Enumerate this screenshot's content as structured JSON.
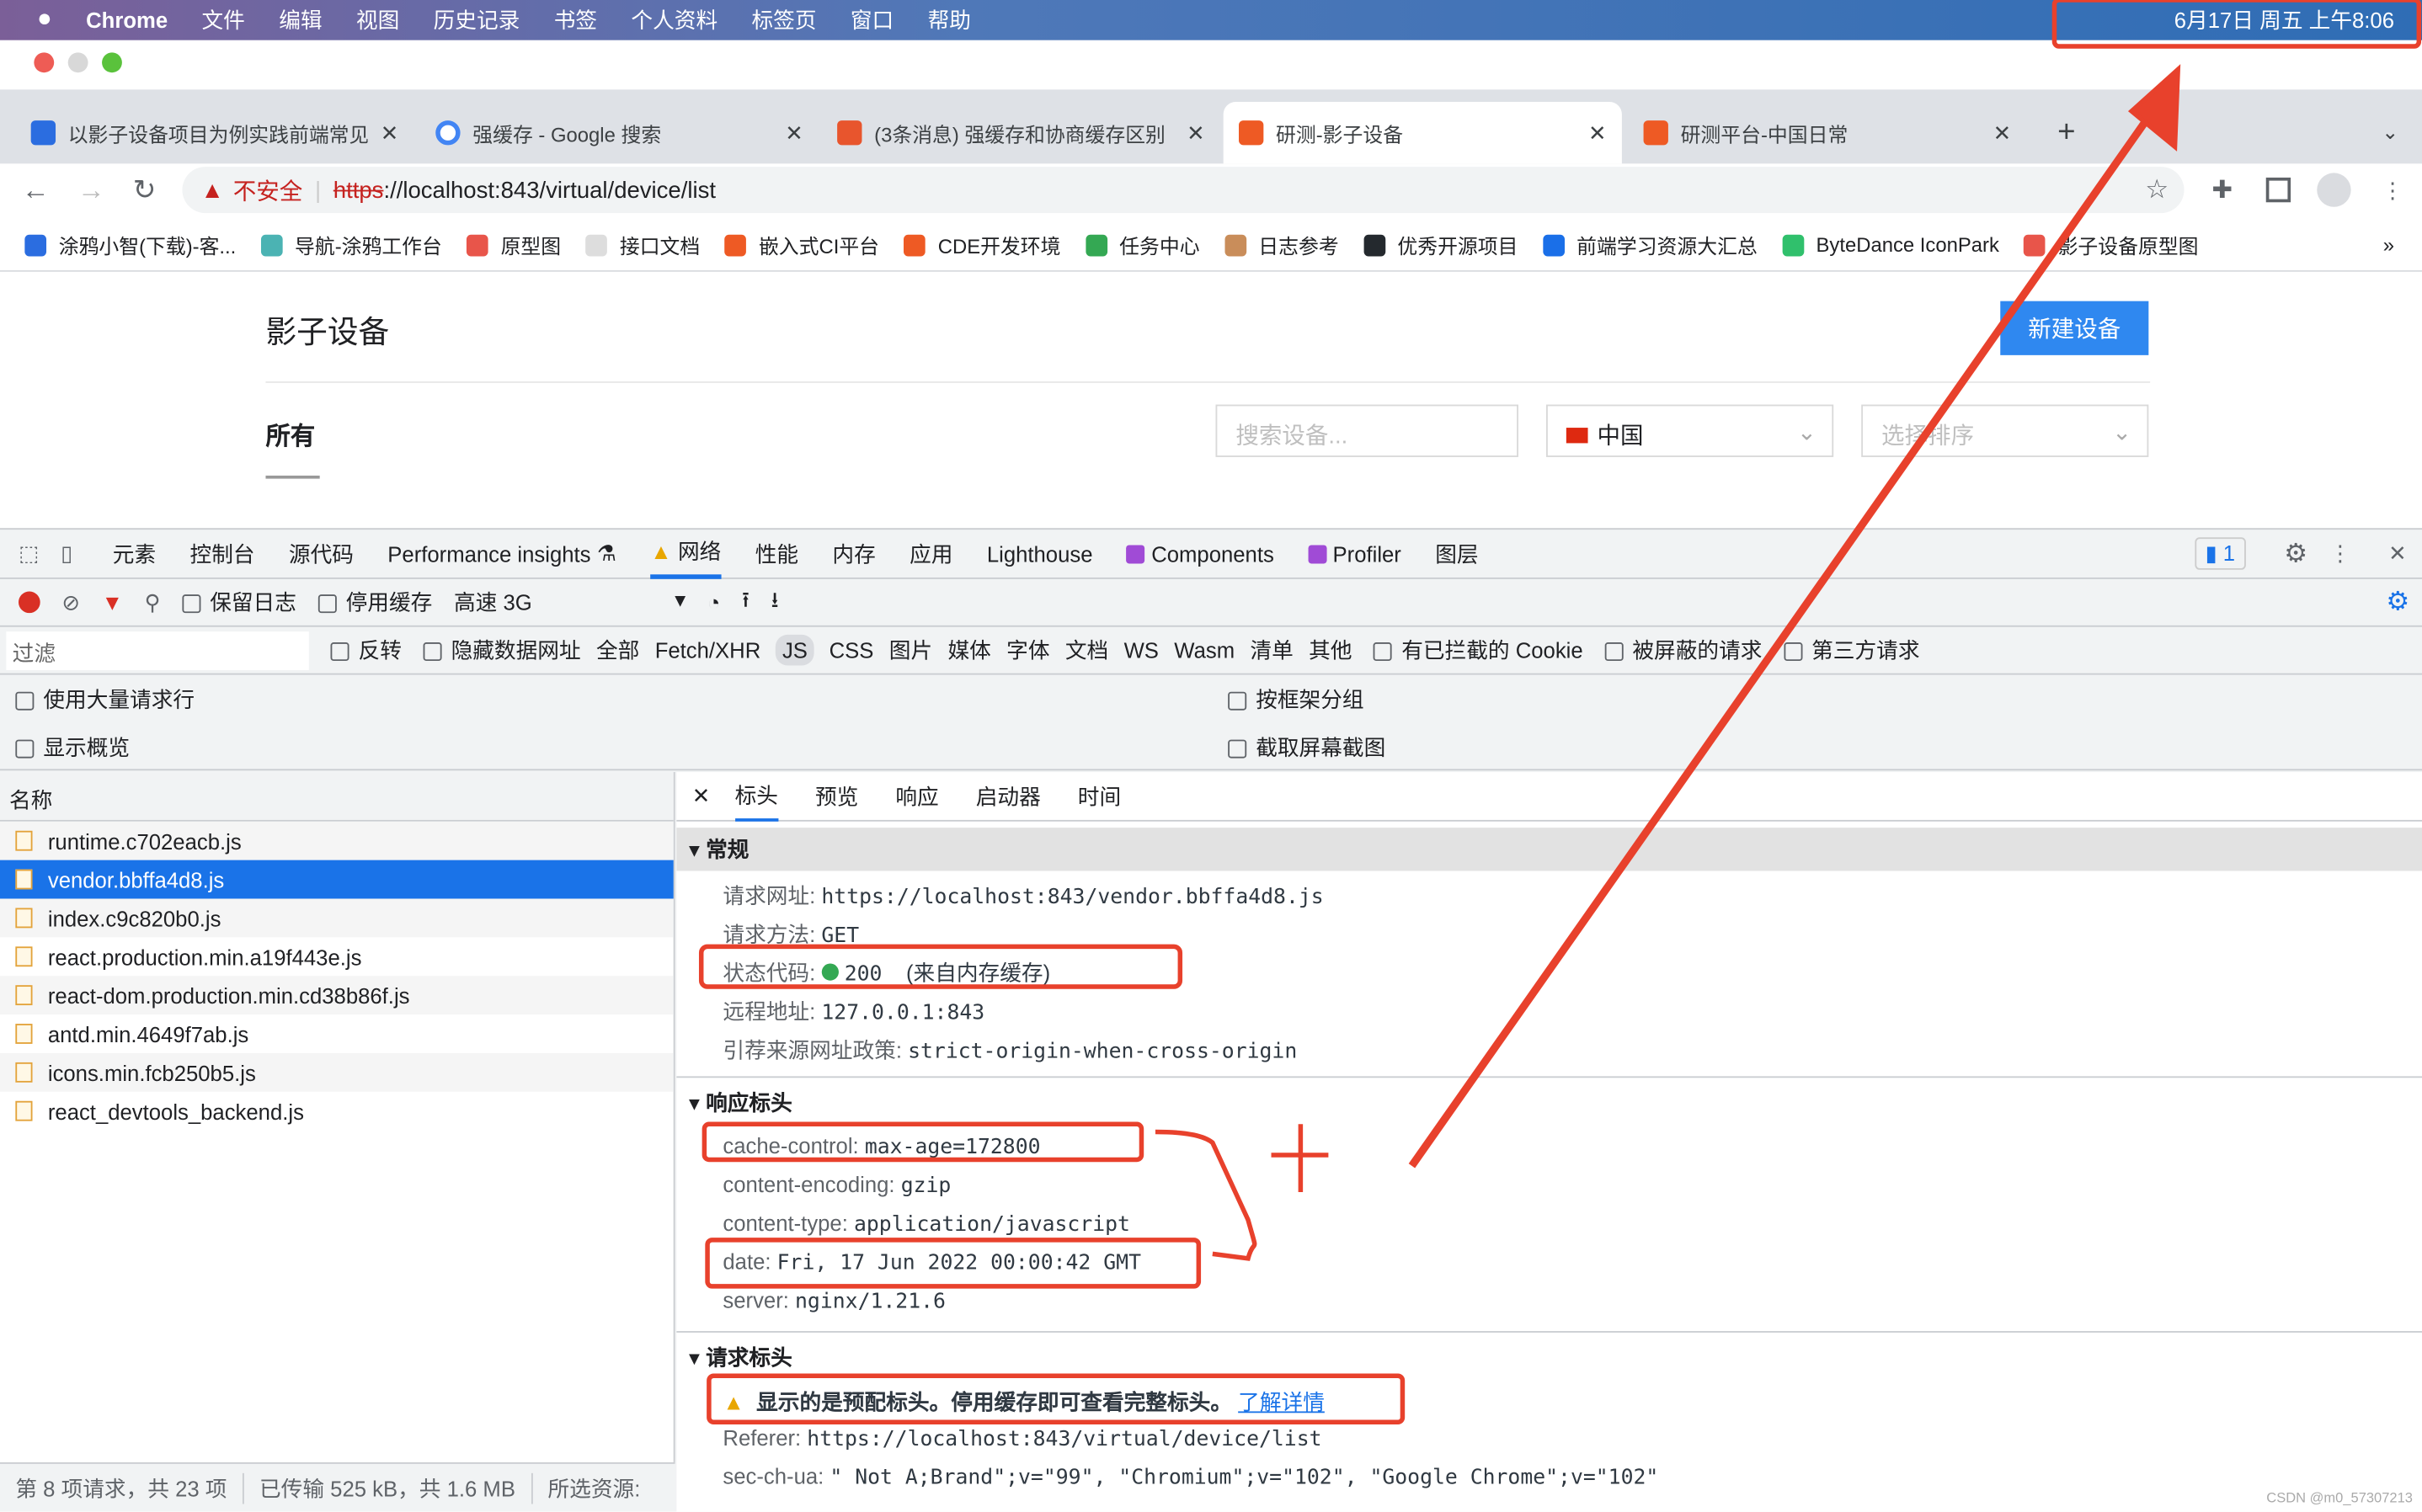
{
  "menubar": {
    "apple": "",
    "app": "Chrome",
    "items": [
      "文件",
      "编辑",
      "视图",
      "历史记录",
      "书签",
      "个人资料",
      "标签页",
      "窗口",
      "帮助"
    ],
    "clock": "6月17日 周五 上午8:06"
  },
  "tabs": [
    {
      "label": "以影子设备项目为例实践前端常见",
      "color": "#2b6de0"
    },
    {
      "label": "强缓存 - Google 搜索",
      "color": "#4285f4"
    },
    {
      "label": "(3条消息) 强缓存和协商缓存区别",
      "color": "#e8552d"
    },
    {
      "label": "研测-影子设备",
      "color": "#ee5a24",
      "active": true
    },
    {
      "label": "研测平台-中国日常",
      "color": "#ee5a24"
    }
  ],
  "address": {
    "security": "不安全",
    "scheme": "https",
    "rest": "://localhost:843/virtual/device/list"
  },
  "bookmarks": [
    "涂鸦小智(下载)-客...",
    "导航-涂鸦工作台",
    "原型图",
    "接口文档",
    "嵌入式CI平台",
    "CDE开发环境",
    "任务中心",
    "日志参考",
    "优秀开源项目",
    "前端学习资源大汇总",
    "ByteDance IconPark",
    "影子设备原型图"
  ],
  "page": {
    "title": "影子设备",
    "new_button": "新建设备",
    "tab_all": "所有",
    "search_placeholder": "搜索设备...",
    "region": "中国",
    "sort_placeholder": "选择排序"
  },
  "devtools": {
    "tabs": [
      "元素",
      "控制台",
      "源代码",
      "Performance insights",
      "网络",
      "性能",
      "内存",
      "应用",
      "Lighthouse",
      "Components",
      "Profiler",
      "图层"
    ],
    "active_tab": "网络",
    "issues_count": "1",
    "toolbar": {
      "preserve_log": "保留日志",
      "disable_cache": "停用缓存",
      "throttle": "高速 3G"
    },
    "filter": {
      "placeholder": "过滤",
      "invert": "反转",
      "hide_data_urls": "隐藏数据网址",
      "types": [
        "全部",
        "Fetch/XHR",
        "JS",
        "CSS",
        "图片",
        "媒体",
        "字体",
        "文档",
        "WS",
        "Wasm",
        "清单",
        "其他"
      ],
      "active_type": "JS",
      "blocked_cookies": "有已拦截的 Cookie",
      "blocked_requests": "被屏蔽的请求",
      "third_party": "第三方请求"
    },
    "options": {
      "large_rows": "使用大量请求行",
      "group_by_frame": "按框架分组",
      "overview": "显示概览",
      "screenshots": "截取屏幕截图"
    },
    "list_header": "名称",
    "requests": [
      "runtime.c702eacb.js",
      "vendor.bbffa4d8.js",
      "index.c9c820b0.js",
      "react.production.min.a19f443e.js",
      "react-dom.production.min.cd38b86f.js",
      "antd.min.4649f7ab.js",
      "icons.min.fcb250b5.js",
      "react_devtools_backend.js"
    ],
    "selected_request": "vendor.bbffa4d8.js",
    "status": [
      "第 8 项请求，共 23 项",
      "已传输 525 kB，共 1.6 MB",
      "所选资源:"
    ],
    "detail_tabs": [
      "标头",
      "预览",
      "响应",
      "启动器",
      "时间"
    ],
    "general": {
      "title": "常规",
      "rows": [
        {
          "k": "请求网址:",
          "v": "https://localhost:843/vendor.bbffa4d8.js"
        },
        {
          "k": "请求方法:",
          "v": "GET"
        },
        {
          "k": "状态代码:",
          "v": "200",
          "note": "(来自内存缓存)"
        },
        {
          "k": "远程地址:",
          "v": "127.0.0.1:843"
        },
        {
          "k": "引荐来源网址政策:",
          "v": "strict-origin-when-cross-origin"
        }
      ]
    },
    "response": {
      "title": "响应标头",
      "rows": [
        {
          "k": "cache-control:",
          "v": "max-age=172800"
        },
        {
          "k": "content-encoding:",
          "v": "gzip"
        },
        {
          "k": "content-type:",
          "v": "application/javascript"
        },
        {
          "k": "date:",
          "v": "Fri, 17 Jun 2022 00:00:42 GMT"
        },
        {
          "k": "server:",
          "v": "nginx/1.21.6"
        }
      ]
    },
    "request": {
      "title": "请求标头",
      "warning": "显示的是预配标头。停用缓存即可查看完整标头。",
      "learn_more": "了解详情",
      "rows": [
        {
          "k": "Referer:",
          "v": "https://localhost:843/virtual/device/list"
        },
        {
          "k": "sec-ch-ua:",
          "v": "\" Not A;Brand\";v=\"99\", \"Chromium\";v=\"102\", \"Google Chrome\";v=\"102\""
        }
      ]
    }
  },
  "watermark": "CSDN @m0_57307213",
  "colors": {
    "accent": "#1a73e8",
    "annotation": "#e8412c",
    "button": "#2f88f0"
  }
}
